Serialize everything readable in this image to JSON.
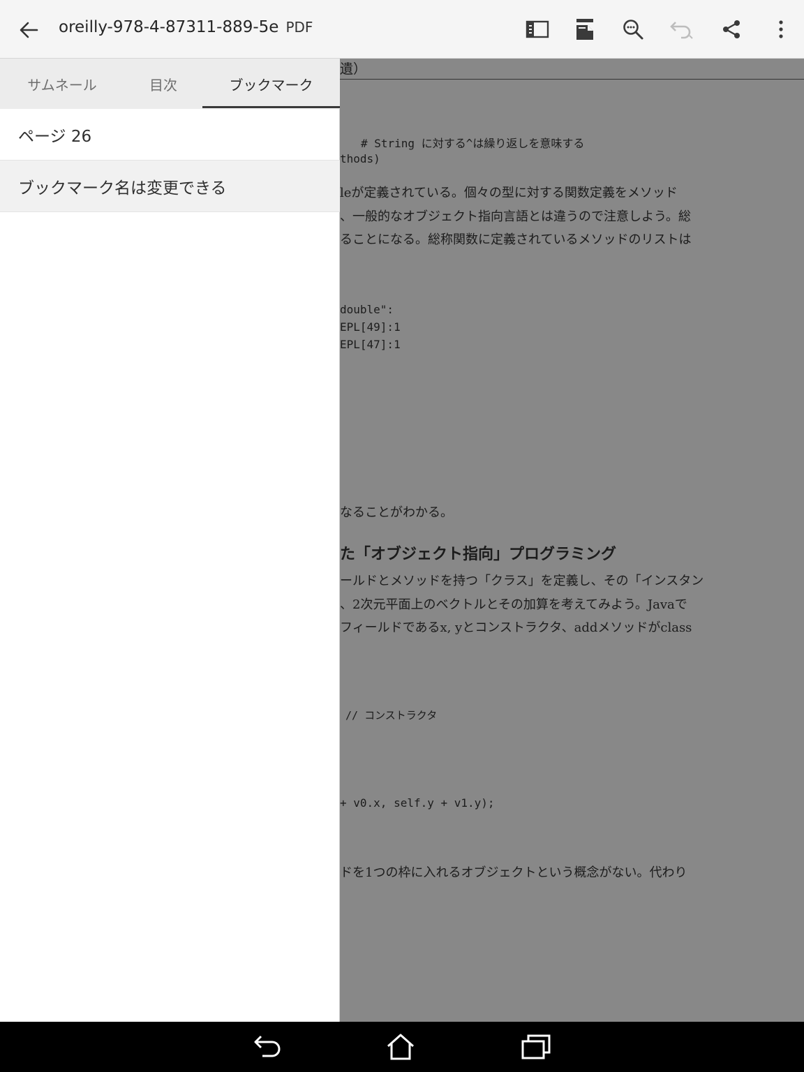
{
  "appbar": {
    "title": "oreilly-978-4-87311-889-5e",
    "file_type": "PDF",
    "icons": [
      "back-arrow-icon",
      "sidebar-toggle-icon",
      "page-mode-icon",
      "search-icon",
      "undo-icon",
      "share-icon",
      "more-vert-icon"
    ]
  },
  "panel": {
    "tabs": [
      {
        "label": "サムネール",
        "active": false
      },
      {
        "label": "目次",
        "active": false
      },
      {
        "label": "ブックマーク",
        "active": true
      }
    ],
    "bookmarks": [
      {
        "label": "ページ 26",
        "selected": false
      },
      {
        "label": "ブックマーク名は変更できる",
        "selected": true
      }
    ]
  },
  "document": {
    "lines": [
      "遺）",
      "# String に対する^は繰り返しを意味する",
      "thods)",
      "leが定義されている。個々の型に対する関数定義をメソッド",
      "、一般的なオブジェクト指向言語とは違うので注意しよう。総",
      "ることになる。総称関数に定義されているメソッドのリストは",
      "double\":",
      "EPL[49]:1",
      "EPL[47]:1",
      "なることがわかる。",
      "た「オブジェクト指向」プログラミング",
      "ールドとメソッドを持つ「クラス」を定義し、その「インスタン",
      "、2次元平面上のベクトルとその加算を考えてみよう。Javaで",
      "フィールドであるx, yとコンストラクタ、addメソッドがclass",
      "// コンストラクタ",
      "+ v0.x, self.y + v1.y);",
      "ドを1つの枠に入れるオブジェクトという概念がない。代わり"
    ]
  },
  "navbar": {
    "icons": [
      "back-nav-icon",
      "home-icon",
      "recent-apps-icon"
    ]
  },
  "colors": {
    "appbar_bg": "#f5f5f5",
    "doc_dim": "#888888",
    "tab_bar_bg": "#ececec",
    "nav_bg": "#000000"
  }
}
